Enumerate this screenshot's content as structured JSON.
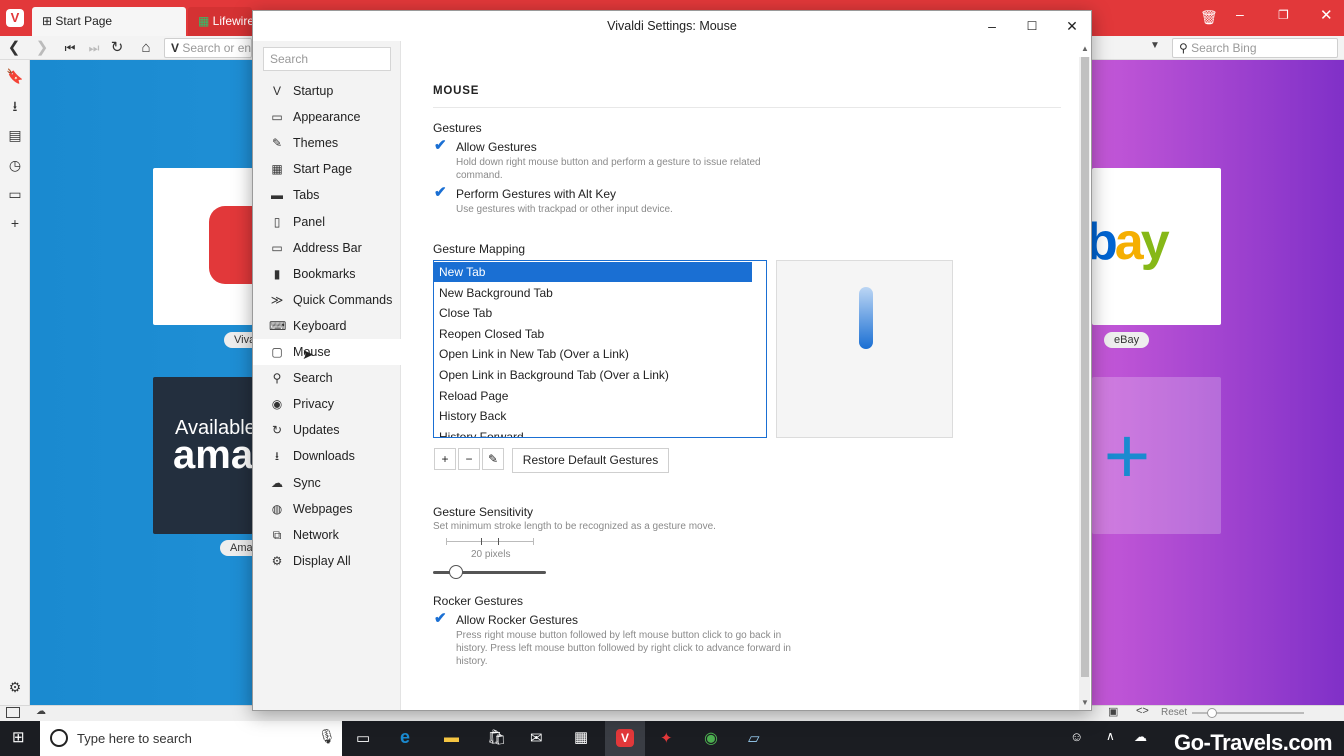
{
  "browser": {
    "tabs": [
      {
        "label": "Start Page"
      },
      {
        "label": "Lifewire"
      }
    ],
    "address_placeholder": "Search or en",
    "search_engine_placeholder": "Search Bing",
    "speed_dial": [
      {
        "label": "Viva"
      },
      {
        "label": "eBay",
        "logo": "ebay"
      },
      {
        "label": "Ama",
        "text_line1": "Available",
        "text_line2": "ama"
      }
    ],
    "status": {
      "reset_label": "Reset"
    }
  },
  "taskbar": {
    "search_placeholder": "Type here to search",
    "watermark": "Go-Travels.com"
  },
  "dialog": {
    "title": "Vivaldi Settings: Mouse",
    "search_placeholder": "Search",
    "nav": [
      {
        "label": "Startup",
        "icon": "vivaldi-icon"
      },
      {
        "label": "Appearance",
        "icon": "window-icon"
      },
      {
        "label": "Themes",
        "icon": "brush-icon"
      },
      {
        "label": "Start Page",
        "icon": "grid-icon"
      },
      {
        "label": "Tabs",
        "icon": "tabs-icon"
      },
      {
        "label": "Panel",
        "icon": "panel-icon"
      },
      {
        "label": "Address Bar",
        "icon": "address-bar-icon"
      },
      {
        "label": "Bookmarks",
        "icon": "bookmark-icon"
      },
      {
        "label": "Quick Commands",
        "icon": "quick-commands-icon"
      },
      {
        "label": "Keyboard",
        "icon": "keyboard-icon"
      },
      {
        "label": "Mouse",
        "icon": "mouse-icon"
      },
      {
        "label": "Search",
        "icon": "search-icon"
      },
      {
        "label": "Privacy",
        "icon": "eye-icon"
      },
      {
        "label": "Updates",
        "icon": "refresh-icon"
      },
      {
        "label": "Downloads",
        "icon": "download-icon"
      },
      {
        "label": "Sync",
        "icon": "cloud-icon"
      },
      {
        "label": "Webpages",
        "icon": "globe-icon"
      },
      {
        "label": "Network",
        "icon": "network-icon"
      },
      {
        "label": "Display All",
        "icon": "gear-icon"
      }
    ],
    "active_nav": "Mouse",
    "section_title": "MOUSE",
    "gestures": {
      "heading": "Gestures",
      "allow_label": "Allow Gestures",
      "allow_checked": true,
      "allow_hint": "Hold down right mouse button and perform a gesture to issue related command.",
      "alt_label": "Perform Gestures with Alt Key",
      "alt_checked": true,
      "alt_hint": "Use gestures with trackpad or other input device."
    },
    "mapping": {
      "heading": "Gesture Mapping",
      "items": [
        "New Tab",
        "New Background Tab",
        "Close Tab",
        "Reopen Closed Tab",
        "Open Link in New Tab (Over a Link)",
        "Open Link in Background Tab (Over a Link)",
        "Reload Page",
        "History Back",
        "History Forward"
      ],
      "selected": "New Tab",
      "restore_label": "Restore Default Gestures"
    },
    "sensitivity": {
      "heading": "Gesture Sensitivity",
      "hint": "Set minimum stroke length to be recognized as a gesture move.",
      "value_label": "20 pixels",
      "slider_fraction": 0.2
    },
    "rocker": {
      "heading": "Rocker Gestures",
      "allow_label": "Allow Rocker Gestures",
      "allow_checked": true,
      "hint": "Press right mouse button followed by left mouse button click to go back in history. Press left mouse button followed by right click to advance forward in history."
    }
  },
  "colors": {
    "accent": "#1a6fd3",
    "vivaldi_red": "#e2383a"
  }
}
